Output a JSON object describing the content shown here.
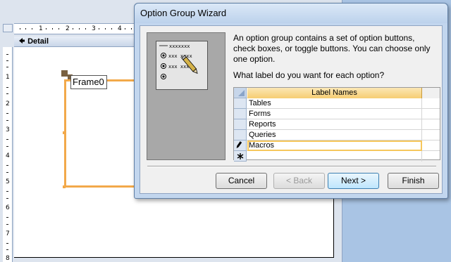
{
  "designer": {
    "section_label": "Detail",
    "ruler_h_numbers": [
      "1",
      "2",
      "3",
      "4"
    ],
    "ruler_v_numbers": [
      "1",
      "2",
      "3",
      "4",
      "5",
      "6",
      "7",
      "8"
    ],
    "frame_label": "Frame0"
  },
  "wizard": {
    "title": "Option Group Wizard",
    "description": "An option group contains a set of option buttons, check boxes, or toggle buttons. You can choose only one option.",
    "prompt": "What label do you want for each option?",
    "grid": {
      "header": "Label Names",
      "rows": [
        "Tables",
        "Forms",
        "Reports",
        "Queries",
        "Macros",
        ""
      ]
    },
    "buttons": {
      "cancel": "Cancel",
      "back": "< Back",
      "next": "Next >",
      "finish": "Finish"
    },
    "illustration_placeholders": [
      "xxxxxxx",
      "xxx xxxx",
      "xxx xxx"
    ]
  },
  "colors": {
    "accent_orange": "#f2a94a",
    "grid_header": "#f6cd72",
    "title_bar": "#c2d6ee"
  }
}
